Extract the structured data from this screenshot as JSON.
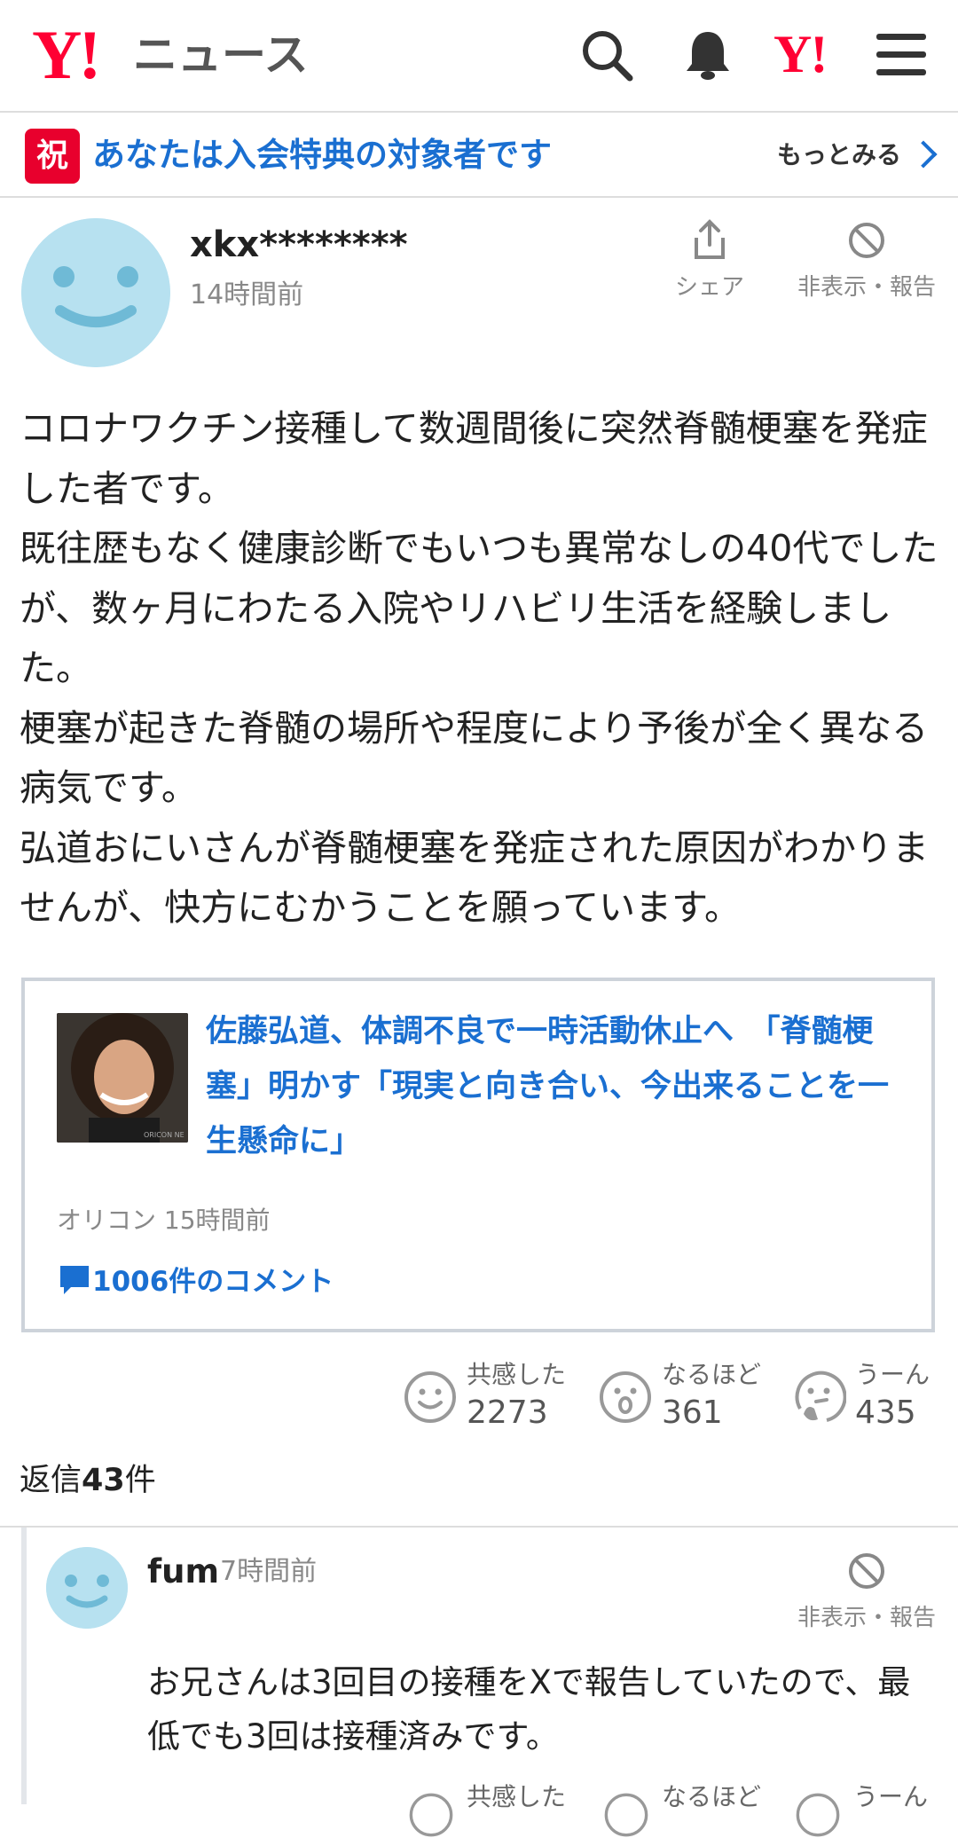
{
  "header": {
    "logo_mark": "Y!",
    "logo_text": "ニュース",
    "yahoo_mark": "Y!"
  },
  "banner": {
    "badge": "祝",
    "text": "あなたは入会特典の対象者です",
    "more": "もっとみる"
  },
  "comment": {
    "user": "xkx********",
    "time": "14時間前",
    "share_label": "シェア",
    "report_label": "非表示・報告",
    "body": "コロナワクチン接種して数週間後に突然脊髄梗塞を発症した者です。\n既往歴もなく健康診断でもいつも異常なしの40代でしたが、数ヶ月にわたる入院やリハビリ生活を経験しました。\n梗塞が起きた脊髄の場所や程度により予後が全く異なる病気です。\n弘道おにいさんが脊髄梗塞を発症された原因がわかりませんが、快方にむかうことを願っています。",
    "article": {
      "title": "佐藤弘道、体調不良で一時活動休止へ　「脊髄梗塞」明かす「現実と向き合い、今出来ることを一生懸命に」",
      "source": "オリコン 15時間前",
      "comments": "1006件のコメント",
      "thumb_watermark": "ORICON NE"
    },
    "reactions": [
      {
        "label": "共感した",
        "count": "2273"
      },
      {
        "label": "なるほど",
        "count": "361"
      },
      {
        "label": "うーん",
        "count": "435"
      }
    ],
    "reply_prefix": "返信",
    "reply_count": "43",
    "reply_suffix": "件"
  },
  "reply": {
    "user": "fum",
    "time": "7時間前",
    "report_label": "非表示・報告",
    "body": "お兄さんは3回目の接種をXで報告していたので、最低でも3回は接種済みです。",
    "reactions": [
      {
        "label": "共感した"
      },
      {
        "label": "なるほど"
      },
      {
        "label": "うーん"
      }
    ]
  },
  "colors": {
    "brand_red": "#ff0033",
    "link_blue": "#1a6fd1",
    "avatar_blue": "#b7e1f0"
  }
}
